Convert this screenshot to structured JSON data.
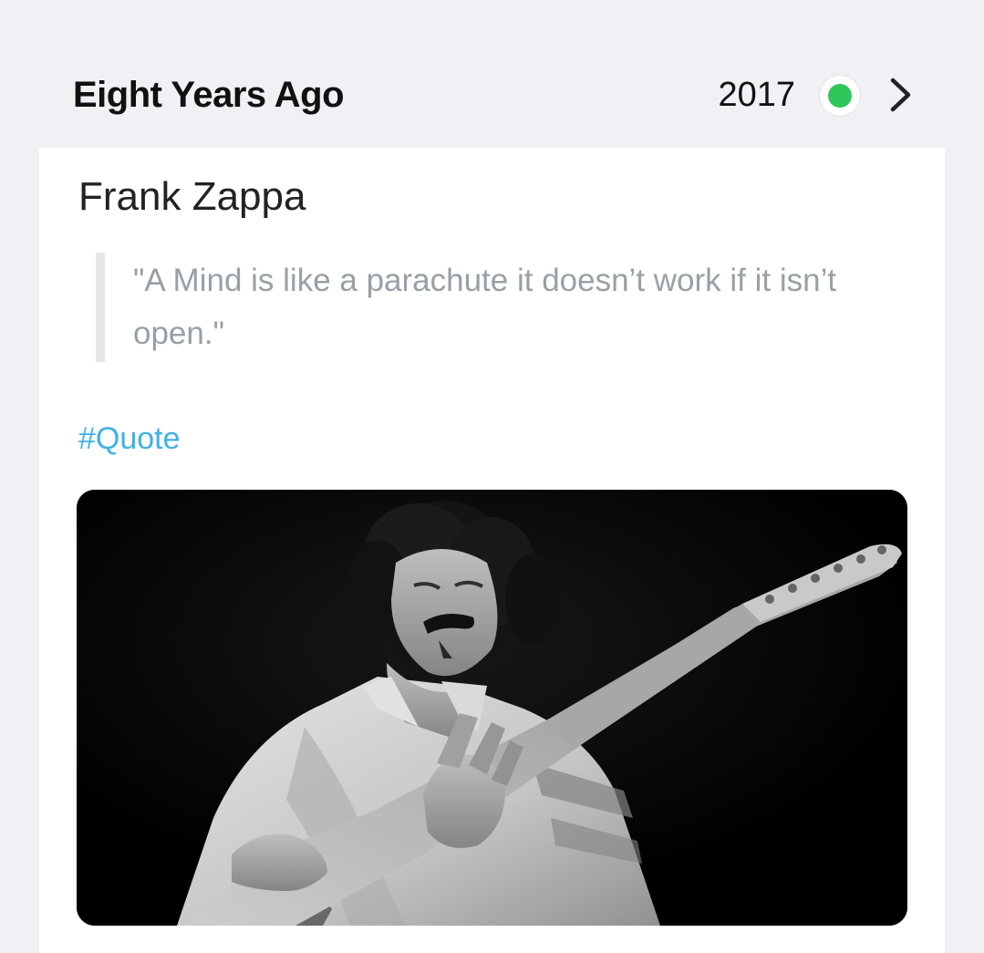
{
  "header": {
    "title": "Eight Years Ago",
    "year": "2017",
    "status_color": "#2fc75a",
    "status_icon": "green-dot-icon",
    "nav_icon": "chevron-right-icon"
  },
  "entry": {
    "name": "Frank Zappa",
    "quote": "\"A Mind is like a parachute it doesn’t work if it isn’t open.\"",
    "tag": "#Quote",
    "tag_color": "#3fb2e3",
    "photo": "black-and-white photo of Frank Zappa playing guitar"
  }
}
